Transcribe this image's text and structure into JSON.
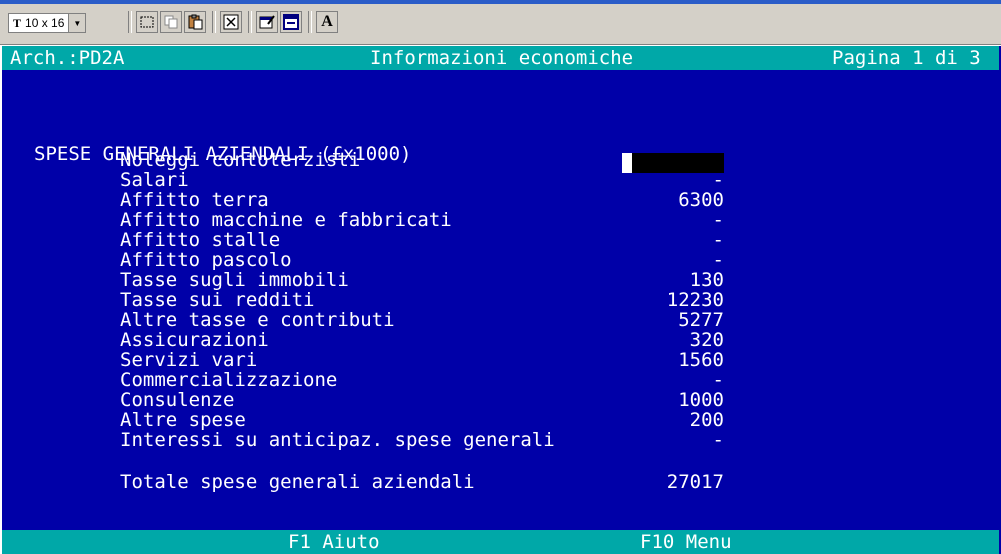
{
  "toolbar": {
    "font_size_label": "10 x 16",
    "buttons": [
      {
        "name": "select-icon"
      },
      {
        "name": "copy-icon"
      },
      {
        "name": "paste-icon"
      },
      {
        "name": "fullscreen-icon"
      },
      {
        "name": "properties-icon"
      },
      {
        "name": "background-icon"
      },
      {
        "name": "font-icon",
        "glyph": "A"
      }
    ]
  },
  "header": {
    "archive": "Arch.:PD2A",
    "title": "Informazioni economiche",
    "page": "Pagina 1 di 3"
  },
  "section": {
    "title": "SPESE GENERALI AZIENDALI (£x1000)"
  },
  "items": [
    {
      "label": "Noleggi contoterzisti",
      "value": ""
    },
    {
      "label": "Salari",
      "value": "-"
    },
    {
      "label": "Affitto terra",
      "value": "6300"
    },
    {
      "label": "Affitto macchine e fabbricati",
      "value": "-"
    },
    {
      "label": "Affitto stalle",
      "value": "-"
    },
    {
      "label": "Affitto pascolo",
      "value": "-"
    },
    {
      "label": "Tasse sugli immobili",
      "value": "130"
    },
    {
      "label": "Tasse sui redditi",
      "value": "12230"
    },
    {
      "label": "Altre tasse e contributi",
      "value": "5277"
    },
    {
      "label": "Assicurazioni",
      "value": "320"
    },
    {
      "label": "Servizi vari",
      "value": "1560"
    },
    {
      "label": "Commercializzazione",
      "value": "-"
    },
    {
      "label": "Consulenze",
      "value": "1000"
    },
    {
      "label": "Altre spese",
      "value": "200"
    },
    {
      "label": "Interessi su anticipaz. spese generali",
      "value": "-"
    }
  ],
  "total": {
    "label": "Totale spese generali aziendali",
    "value": "27017"
  },
  "footer": {
    "help": "F1 Aiuto",
    "menu": "F10 Menu"
  },
  "colors": {
    "background": "#0000a8",
    "bars": "#00a8a8",
    "text": "#ffffff"
  }
}
